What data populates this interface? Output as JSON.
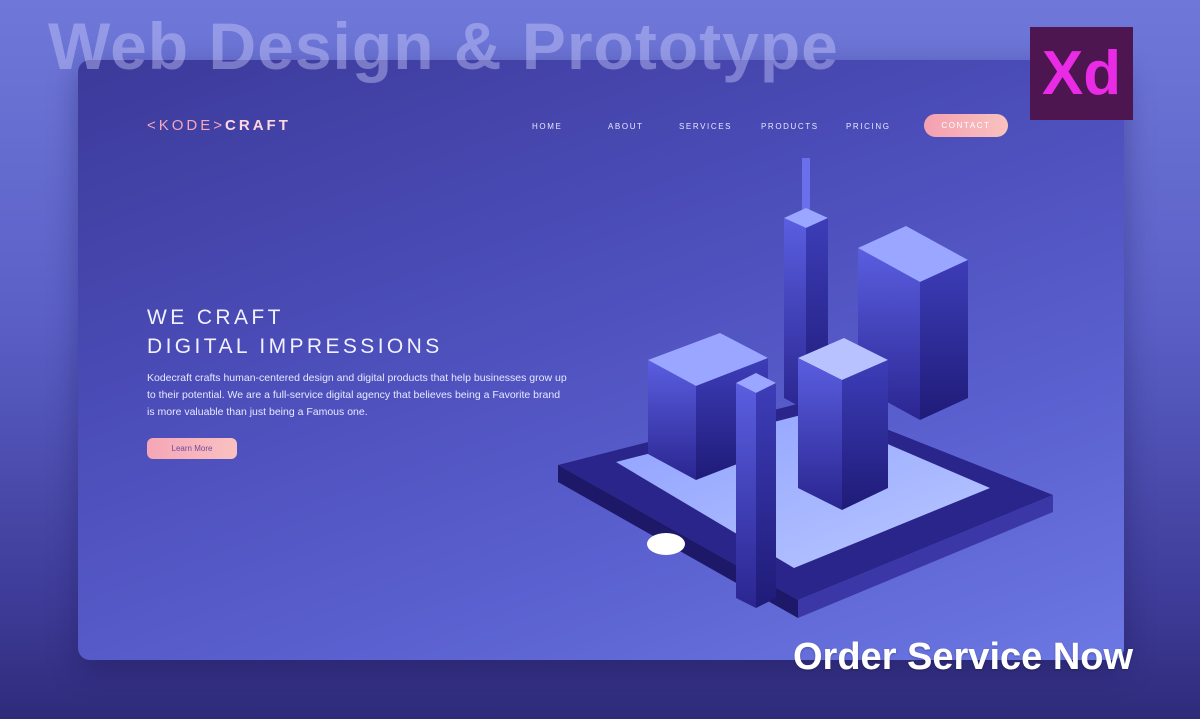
{
  "banner": {
    "title": "Web Design & Prototype",
    "cta": "Order Service Now"
  },
  "badge": {
    "text": "Xd",
    "icon": "adobe-xd-icon",
    "bg": "#4d1650",
    "fg": "#ea2be5"
  },
  "site": {
    "logo": {
      "prefix": "<KODE>",
      "suffix": "CRAFT"
    },
    "nav": [
      {
        "label": "HOME",
        "id": "home"
      },
      {
        "label": "ABOUT",
        "id": "about"
      },
      {
        "label": "SERVICES",
        "id": "services"
      },
      {
        "label": "PRODUCTS",
        "id": "products"
      },
      {
        "label": "PRICING",
        "id": "pricing"
      }
    ],
    "contact_label": "CONTACT",
    "hero": {
      "title_line1": "WE CRAFT",
      "title_line2": "DIGITAL IMPRESSIONS",
      "description": "Kodecraft crafts human-centered design and digital products that help businesses grow up to their potential. We are a full-service digital agency that believes being a Favorite brand is more valuable than just being a Famous one.",
      "button": "Learn More"
    },
    "illustration": "isometric-city-on-phone-icon"
  },
  "colors": {
    "accent": "#f4a0b1",
    "background": "#4a4bb6"
  }
}
